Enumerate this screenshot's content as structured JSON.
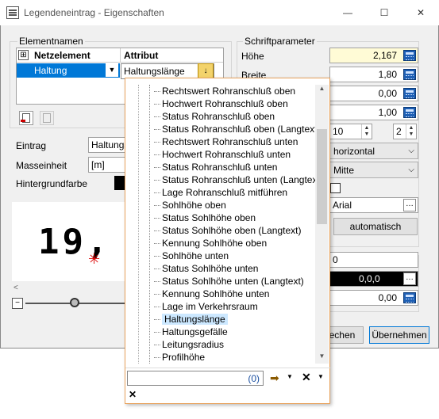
{
  "window": {
    "title": "Legendeneintrag - Eigenschaften",
    "minimize": "—",
    "maximize": "☐",
    "close": "✕"
  },
  "elementnamen": {
    "group_label": "Elementnamen",
    "col_netzelement": "Netzelement",
    "col_attribut": "Attribut",
    "row_netzelement": "Haltung",
    "row_attribut": "Haltungslänge"
  },
  "fields": {
    "eintrag_label": "Eintrag",
    "eintrag_value": "Haltungsl",
    "masseinheit_label": "Masseinheit",
    "masseinheit_value": "[m]",
    "hintergrund_label": "Hintergrundfarbe"
  },
  "preview": {
    "text": "19,"
  },
  "schrift": {
    "group_label": "Schriftparameter",
    "hoehe_label": "Höhe",
    "hoehe_value": "2,167",
    "breite_label": "Breite",
    "breite_value": "1,80",
    "v3": "0,00",
    "v4": "1,00",
    "spin1": "10",
    "spin2": "2",
    "combo_horizontal": "horizontal",
    "combo_mitte": "Mitte",
    "font": "Arial",
    "automatisch": "automatisch",
    "v_lower1": "0",
    "color_value": "0,0,0",
    "v_lower3": "0,00"
  },
  "buttons": {
    "abbrechen_partial": "rechen",
    "uebernehmen": "Übernehmen"
  },
  "popup": {
    "items": [
      "Rechtswert Rohranschluß oben",
      "Hochwert Rohranschluß oben",
      "Status Rohranschluß oben",
      "Status Rohranschluß oben (Langtext)",
      "Rechtswert Rohranschluß unten",
      "Hochwert Rohranschluß unten",
      "Status Rohranschluß unten",
      "Status Rohranschluß unten (Langtext)",
      "Lage Rohranschluß mitführen",
      "Sohlhöhe oben",
      "Status Sohlhöhe oben",
      "Status Sohlhöhe oben (Langtext)",
      "Kennung Sohlhöhe oben",
      "Sohlhöhe unten",
      "Status Sohlhöhe unten",
      "Status Sohlhöhe unten (Langtext)",
      "Kennung Sohlhöhe unten",
      "Lage im Verkehrsraum",
      "Haltungslänge",
      "Haltungsgefälle",
      "Leitungsradius",
      "Profilhöhe"
    ],
    "selected_index": 18,
    "filter_count": "(0)",
    "close_x": "✕"
  },
  "colors": {
    "accent": "#e8a35d",
    "selection": "#cce8ff",
    "highlight_row": "#0078d7",
    "hoehe_bg": "#fffbd6"
  }
}
